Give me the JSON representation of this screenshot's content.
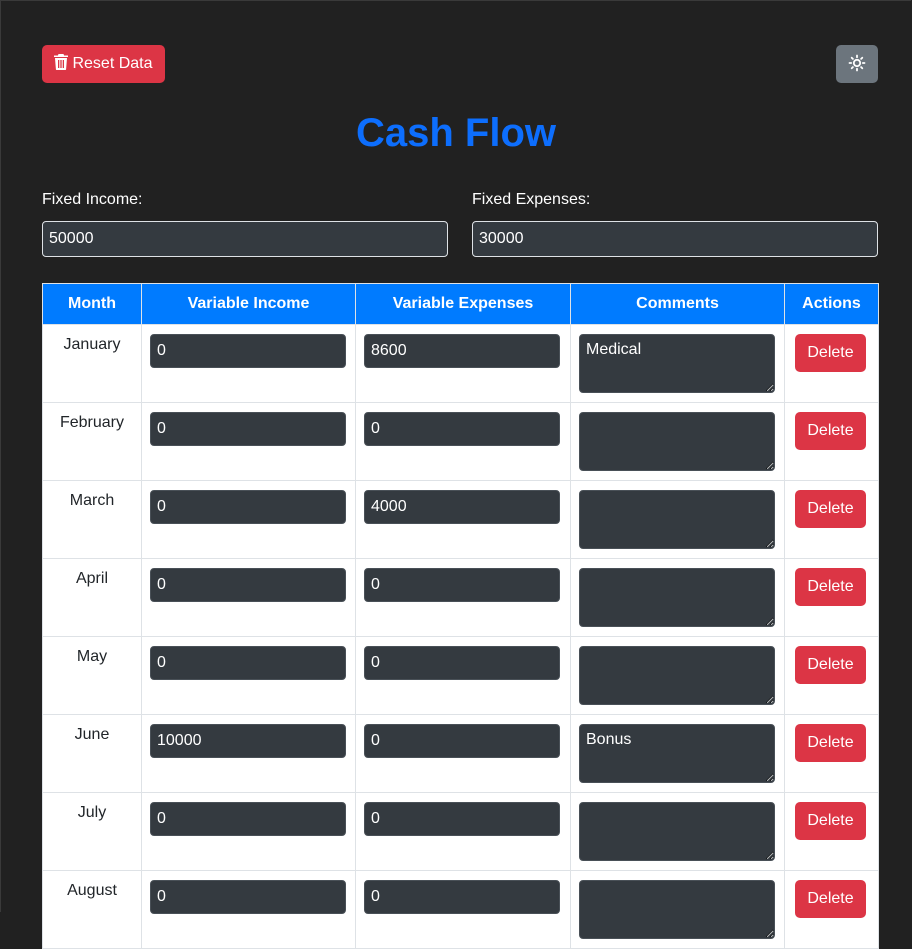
{
  "toolbar": {
    "reset_label": "Reset Data",
    "reset_icon": "trash-icon",
    "theme_icon": "sun-icon"
  },
  "page_title": "Cash Flow",
  "fixed": {
    "income_label": "Fixed Income:",
    "income_value": "50000",
    "expenses_label": "Fixed Expenses:",
    "expenses_value": "30000"
  },
  "table": {
    "headers": [
      "Month",
      "Variable Income",
      "Variable Expenses",
      "Comments",
      "Actions"
    ],
    "rows": [
      {
        "month": "January",
        "income": "0",
        "expenses": "8600",
        "comment": "Medical",
        "action": "Delete"
      },
      {
        "month": "February",
        "income": "0",
        "expenses": "0",
        "comment": "",
        "action": "Delete"
      },
      {
        "month": "March",
        "income": "0",
        "expenses": "4000",
        "comment": "",
        "action": "Delete"
      },
      {
        "month": "April",
        "income": "0",
        "expenses": "0",
        "comment": "",
        "action": "Delete"
      },
      {
        "month": "May",
        "income": "0",
        "expenses": "0",
        "comment": "",
        "action": "Delete"
      },
      {
        "month": "June",
        "income": "10000",
        "expenses": "0",
        "comment": "Bonus",
        "action": "Delete"
      },
      {
        "month": "July",
        "income": "0",
        "expenses": "0",
        "comment": "",
        "action": "Delete"
      },
      {
        "month": "August",
        "income": "0",
        "expenses": "0",
        "comment": "",
        "action": "Delete"
      }
    ]
  },
  "colors": {
    "background": "#212121",
    "accent": "#0d6efd",
    "header": "#007bff",
    "danger": "#dc3545",
    "secondary": "#6c757d",
    "input": "#343a40"
  }
}
